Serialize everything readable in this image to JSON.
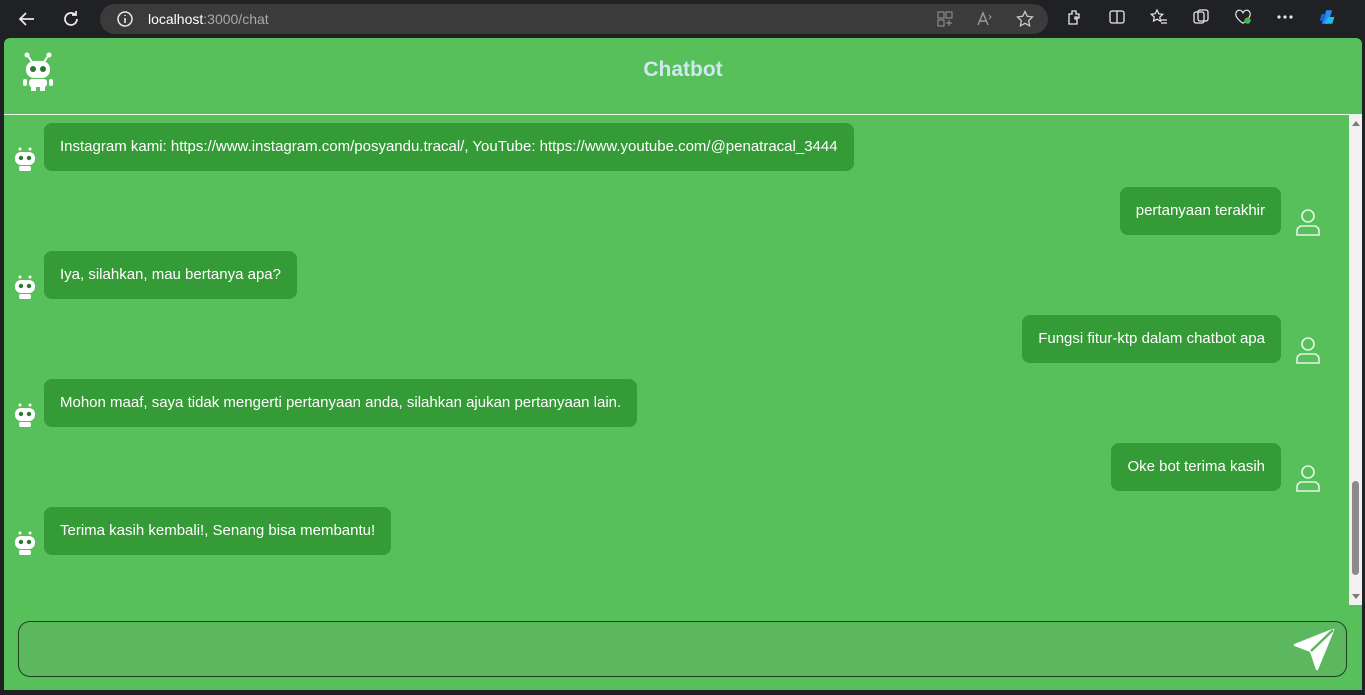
{
  "browser": {
    "url_host": "localhost",
    "url_path": ":3000/chat"
  },
  "app": {
    "title": "Chatbot"
  },
  "messages": [
    {
      "sender": "bot",
      "text": "Instagram kami: https://www.instagram.com/posyandu.tracal/, YouTube: https://www.youtube.com/@penatracal_3444"
    },
    {
      "sender": "user",
      "text": "pertanyaan terakhir"
    },
    {
      "sender": "bot",
      "text": "Iya, silahkan, mau bertanya apa?"
    },
    {
      "sender": "user",
      "text": "Fungsi fitur-ktp dalam chatbot apa"
    },
    {
      "sender": "bot",
      "text": "Mohon maaf, saya tidak mengerti pertanyaan anda, silahkan ajukan pertanyaan lain."
    },
    {
      "sender": "user",
      "text": "Oke bot terima kasih"
    },
    {
      "sender": "bot",
      "text": "Terima kasih kembali!, Senang bisa membantu!"
    }
  ],
  "input": {
    "value": "",
    "placeholder": ""
  },
  "colors": {
    "app_bg": "#57c05a",
    "bubble_bg": "#349b36",
    "title": "#cfe8f2"
  }
}
